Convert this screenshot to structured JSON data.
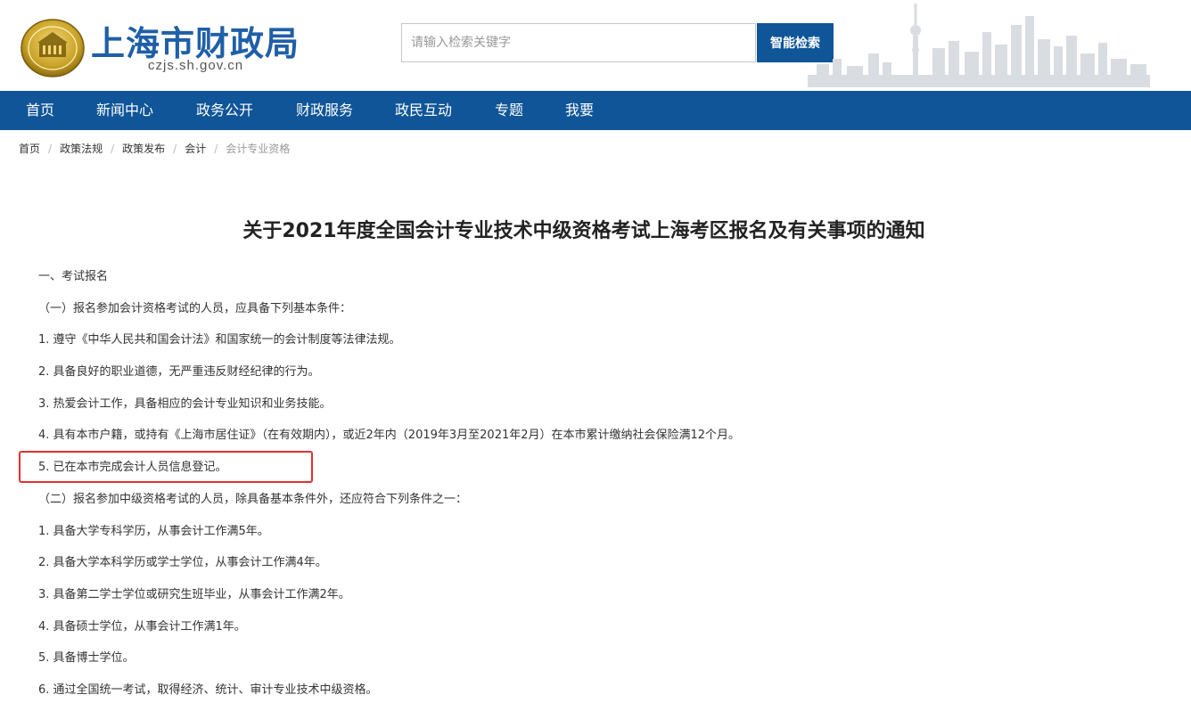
{
  "header": {
    "site_title": "上海市财政局",
    "site_domain": "czjs.sh.gov.cn",
    "search_placeholder": "请输入检索关键字",
    "search_button": "智能检索",
    "logo_icon": "shanghai-finance-emblem-icon",
    "skyline_image": "shanghai-skyline-image"
  },
  "nav": {
    "items": [
      "首页",
      "新闻中心",
      "政务公开",
      "财政服务",
      "政民互动",
      "专题",
      "我要"
    ]
  },
  "breadcrumb": {
    "items": [
      "首页",
      "政策法规",
      "政策发布",
      "会计",
      "会计专业资格"
    ],
    "separator": "/"
  },
  "article": {
    "title": "关于2021年度全国会计专业技术中级资格考试上海考区报名及有关事项的通知",
    "paragraphs": [
      "一、考试报名",
      "（一）报名参加会计资格考试的人员，应具备下列基本条件：",
      "1. 遵守《中华人民共和国会计法》和国家统一的会计制度等法律法规。",
      "2. 具备良好的职业道德，无严重违反财经纪律的行为。",
      "3. 热爱会计工作，具备相应的会计专业知识和业务技能。",
      "4. 具有本市户籍，或持有《上海市居住证》（在有效期内），或近2年内（2019年3月至2021年2月）在本市累计缴纳社会保险满12个月。",
      "5. 已在本市完成会计人员信息登记。",
      "（二）报名参加中级资格考试的人员，除具备基本条件外，还应符合下列条件之一：",
      "1. 具备大学专科学历，从事会计工作满5年。",
      "2. 具备大学本科学历或学士学位，从事会计工作满4年。",
      "3. 具备第二学士学位或研究生班毕业，从事会计工作满2年。",
      "4. 具备硕士学位，从事会计工作满1年。",
      "5. 具备博士学位。",
      "6. 通过全国统一考试，取得经济、统计、审计专业技术中级资格。"
    ]
  },
  "colors": {
    "brand_blue": "#0f5598",
    "title_blue": "#1f5fa8",
    "highlight_red": "#e23030",
    "logo_gold": "#c9a227"
  }
}
